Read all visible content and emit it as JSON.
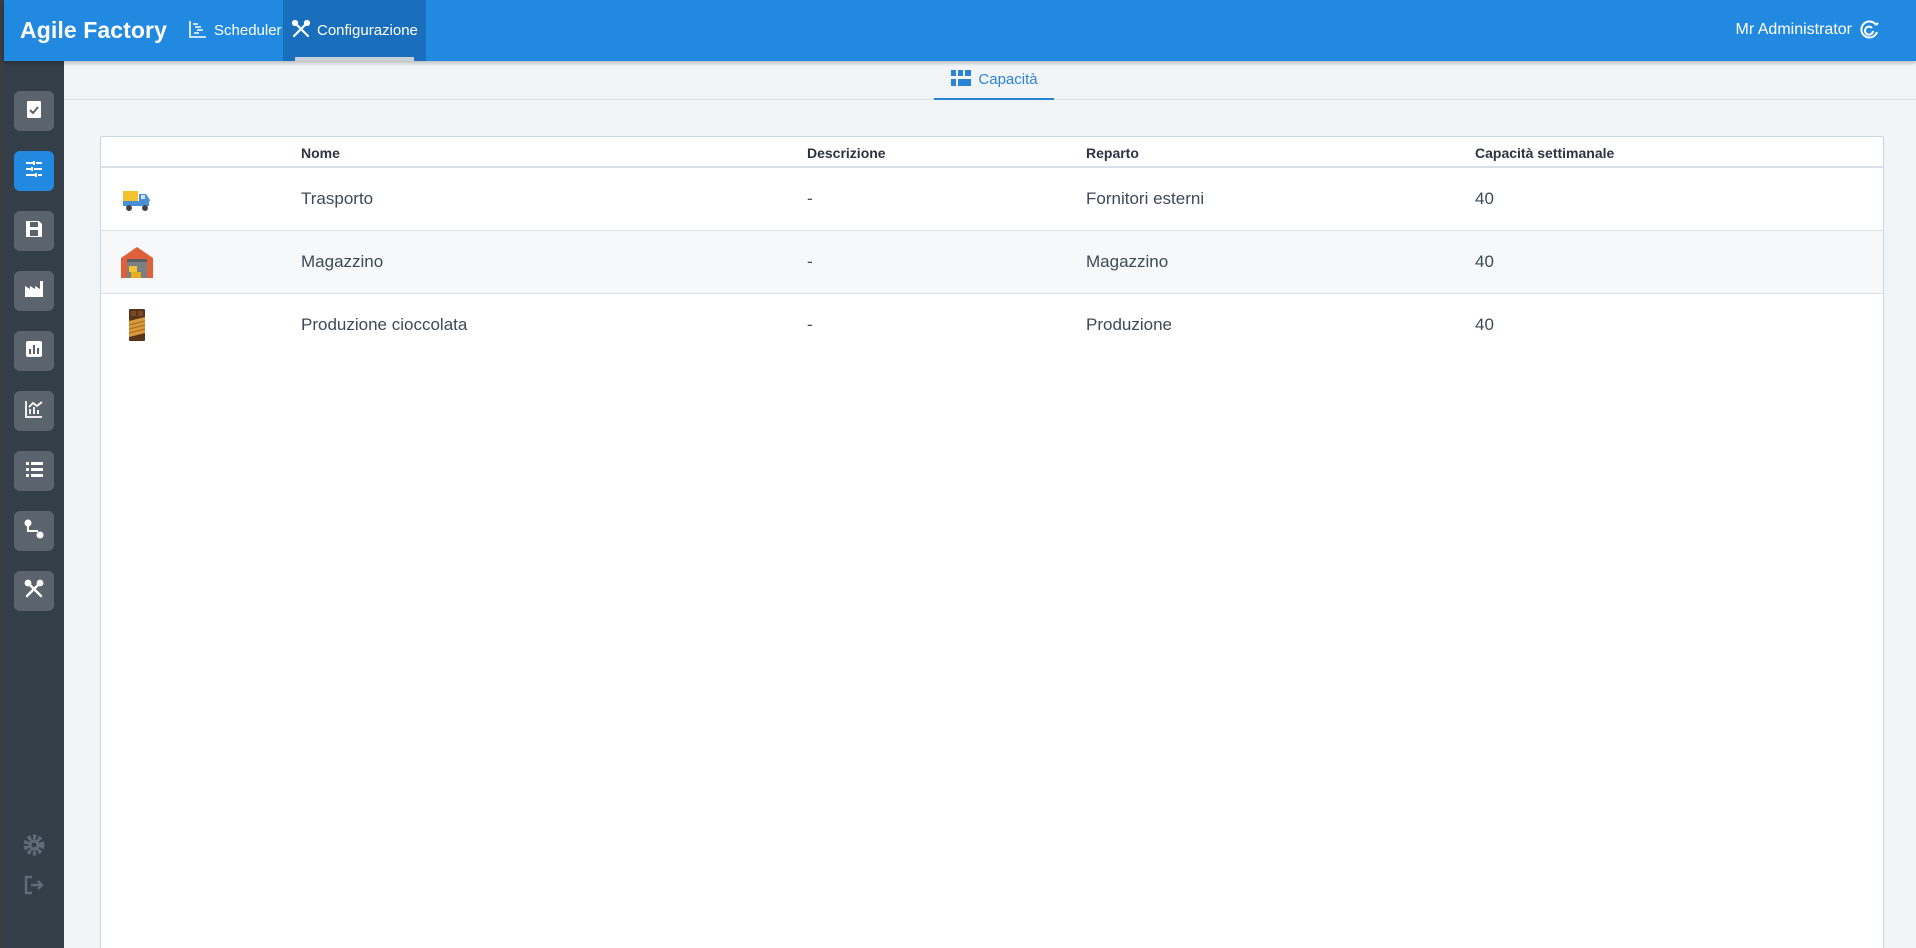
{
  "app": {
    "brand": "Agile Factory",
    "user": "Mr Administrator"
  },
  "nav": [
    {
      "label": "Scheduler",
      "icon": "scheduler-icon",
      "active": false
    },
    {
      "label": "Configurazione",
      "icon": "tools-icon",
      "active": true
    }
  ],
  "sidebar": {
    "items": [
      {
        "icon": "clipboard-check-icon",
        "active": false
      },
      {
        "icon": "sliders-icon",
        "active": true
      },
      {
        "icon": "save-icon",
        "active": false
      },
      {
        "icon": "factory-icon",
        "active": false
      },
      {
        "icon": "bar-chart-icon",
        "active": false
      },
      {
        "icon": "line-chart-icon",
        "active": false
      },
      {
        "icon": "list-icon",
        "active": false
      },
      {
        "icon": "route-icon",
        "active": false
      },
      {
        "icon": "tools-icon",
        "active": false
      }
    ],
    "bottom": [
      {
        "icon": "gear-icon"
      },
      {
        "icon": "logout-icon"
      }
    ]
  },
  "subtab": {
    "label": "Capacità",
    "icon": "capacity-icon"
  },
  "table": {
    "columns": [
      "Nome",
      "Descrizione",
      "Reparto",
      "Capacità settimanale"
    ],
    "rows": [
      {
        "icon": "truck-icon",
        "nome": "Trasporto",
        "descrizione": "-",
        "reparto": "Fornitori esterni",
        "capacita": "40"
      },
      {
        "icon": "warehouse-icon",
        "nome": "Magazzino",
        "descrizione": "-",
        "reparto": "Magazzino",
        "capacita": "40"
      },
      {
        "icon": "chocolate-icon",
        "nome": "Produzione cioccolata",
        "descrizione": "-",
        "reparto": "Produzione",
        "capacita": "40"
      }
    ]
  },
  "colors": {
    "primary": "#2289e0",
    "sidebar": "#343e48",
    "sidebar_button": "#5b646d"
  }
}
